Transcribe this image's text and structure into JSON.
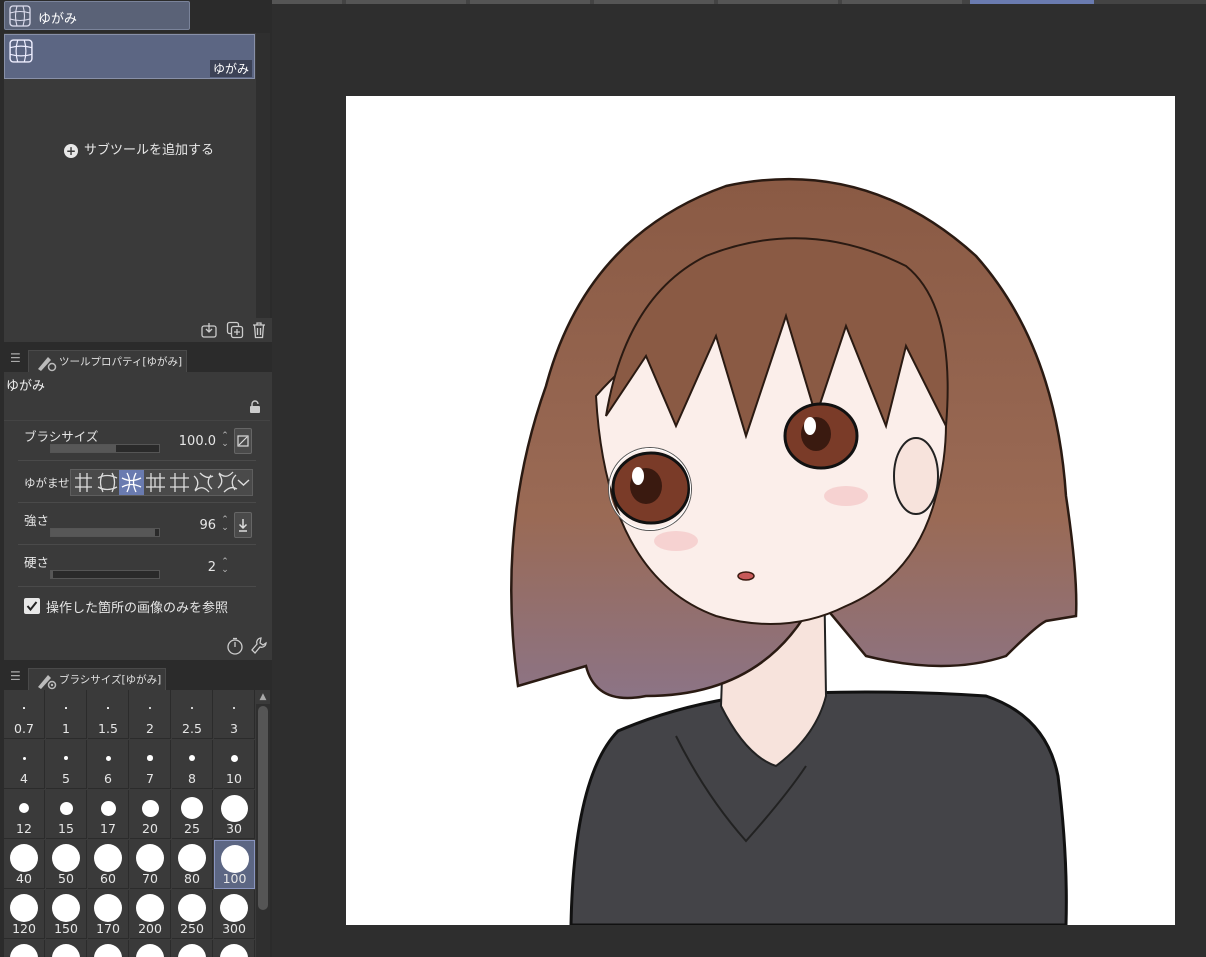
{
  "tool_group": {
    "label": "ゆがみ",
    "icon": "liquify-grid-icon"
  },
  "subtool": {
    "item_label": "ゆがみ",
    "add_label": "サブツールを追加する"
  },
  "tool_property": {
    "tab_label": "ツールプロパティ[ゆがみ]",
    "name": "ゆがみ",
    "brush_size": {
      "label": "ブラシサイズ",
      "value": "100.0",
      "fill": 0.6
    },
    "distort": {
      "label": "ゆがませ",
      "modes": [
        "push",
        "expand",
        "pinch",
        "twist-left",
        "twist-right"
      ],
      "selected": 2
    },
    "strength": {
      "label": "強さ",
      "value": "96",
      "fill": 0.96
    },
    "hardness": {
      "label": "硬さ",
      "value": "2",
      "fill": 0.02
    },
    "reference_checkbox": {
      "label": "操作した箇所の画像のみを参照",
      "checked": true
    }
  },
  "brush_size_panel": {
    "tab_label": "ブラシサイズ[ゆがみ]",
    "sizes": [
      "0.7",
      "1",
      "1.5",
      "2",
      "2.5",
      "3",
      "4",
      "5",
      "6",
      "7",
      "8",
      "10",
      "12",
      "15",
      "17",
      "20",
      "25",
      "30",
      "40",
      "50",
      "60",
      "70",
      "80",
      "100",
      "120",
      "150",
      "170",
      "200",
      "250",
      "300"
    ],
    "selected": "100"
  }
}
